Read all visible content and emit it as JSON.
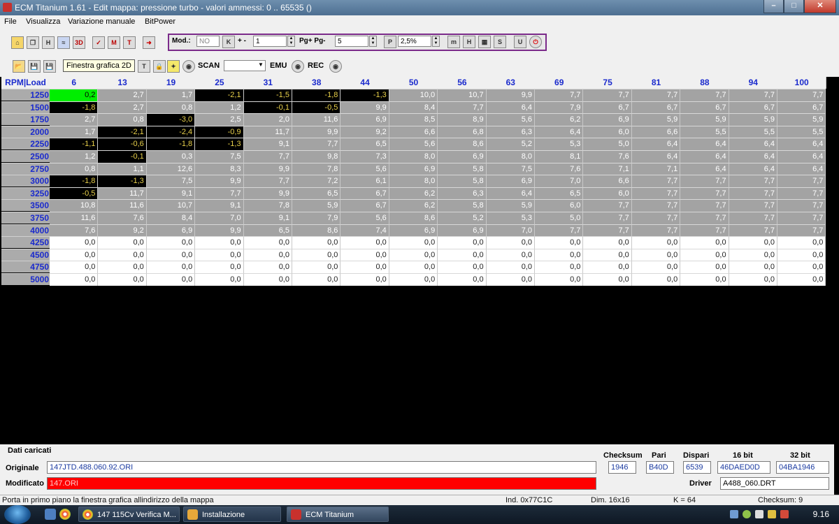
{
  "window": {
    "title": "ECM Titanium 1.61 - Edit mappa: pressione turbo - valori ammessi: 0 .. 65535 ()"
  },
  "menu": [
    "File",
    "Visualizza",
    "Variazione manuale",
    "BitPower"
  ],
  "toolbar": {
    "mod_label": "Mod.:",
    "mod_value": "NO",
    "k_label": "K",
    "plusminus_label": "+ -",
    "step_value": "1",
    "pg_label": "Pg+ Pg-",
    "pg_value": "5",
    "percent_label": "P",
    "percent_value": "2,5%",
    "tooltip": "Finestra grafica 2D",
    "scan_label": "SCAN",
    "scan_value": "",
    "emu_label": "EMU",
    "rec_label": "REC"
  },
  "grid": {
    "corner": "RPM|Load",
    "columns": [
      "6",
      "13",
      "19",
      "25",
      "31",
      "38",
      "44",
      "50",
      "56",
      "63",
      "69",
      "75",
      "81",
      "88",
      "94",
      "100"
    ],
    "rows": [
      {
        "rpm": "1250",
        "values": [
          "0,2",
          "2,7",
          "1,7",
          "-2,1",
          "-1,5",
          "-1,8",
          "-1,3",
          "10,0",
          "10,7",
          "9,9",
          "7,7",
          "7,7",
          "7,7",
          "7,7",
          "7,7",
          "7,7"
        ]
      },
      {
        "rpm": "1500",
        "values": [
          "-1,8",
          "2,7",
          "0,8",
          "1,2",
          "-0,1",
          "-0,5",
          "9,9",
          "8,4",
          "7,7",
          "6,4",
          "7,9",
          "6,7",
          "6,7",
          "6,7",
          "6,7",
          "6,7"
        ]
      },
      {
        "rpm": "1750",
        "values": [
          "2,7",
          "0,8",
          "-3,0",
          "2,5",
          "2,0",
          "11,6",
          "6,9",
          "8,5",
          "8,9",
          "5,6",
          "6,2",
          "6,9",
          "5,9",
          "5,9",
          "5,9",
          "5,9"
        ]
      },
      {
        "rpm": "2000",
        "values": [
          "1,7",
          "-2,1",
          "-2,4",
          "-0,9",
          "11,7",
          "9,9",
          "9,2",
          "6,6",
          "6,8",
          "6,3",
          "6,4",
          "6,0",
          "6,6",
          "5,5",
          "5,5",
          "5,5"
        ]
      },
      {
        "rpm": "2250",
        "values": [
          "-1,1",
          "-0,6",
          "-1,8",
          "-1,3",
          "9,1",
          "7,7",
          "6,5",
          "5,6",
          "8,6",
          "5,2",
          "5,3",
          "5,0",
          "6,4",
          "6,4",
          "6,4",
          "6,4"
        ]
      },
      {
        "rpm": "2500",
        "values": [
          "1,2",
          "-0,1",
          "0,3",
          "7,5",
          "7,7",
          "9,8",
          "7,3",
          "8,0",
          "6,9",
          "8,0",
          "8,1",
          "7,6",
          "6,4",
          "6,4",
          "6,4",
          "6,4"
        ]
      },
      {
        "rpm": "2750",
        "values": [
          "0,8",
          "1,1",
          "12,6",
          "8,3",
          "9,9",
          "7,8",
          "5,6",
          "6,9",
          "5,8",
          "7,5",
          "7,6",
          "7,1",
          "7,1",
          "6,4",
          "6,4",
          "6,4"
        ]
      },
      {
        "rpm": "3000",
        "values": [
          "-1,8",
          "-1,3",
          "7,5",
          "9,9",
          "7,7",
          "7,2",
          "6,1",
          "8,0",
          "5,8",
          "6,9",
          "7,0",
          "6,6",
          "7,7",
          "7,7",
          "7,7",
          "7,7"
        ]
      },
      {
        "rpm": "3250",
        "values": [
          "-0,5",
          "11,7",
          "9,1",
          "7,7",
          "9,9",
          "6,5",
          "6,7",
          "6,2",
          "6,3",
          "6,4",
          "6,5",
          "6,0",
          "7,7",
          "7,7",
          "7,7",
          "7,7"
        ]
      },
      {
        "rpm": "3500",
        "values": [
          "10,8",
          "11,6",
          "10,7",
          "9,1",
          "7,8",
          "5,9",
          "6,7",
          "6,2",
          "5,8",
          "5,9",
          "6,0",
          "7,7",
          "7,7",
          "7,7",
          "7,7",
          "7,7"
        ]
      },
      {
        "rpm": "3750",
        "values": [
          "11,6",
          "7,6",
          "8,4",
          "7,0",
          "9,1",
          "7,9",
          "5,6",
          "8,6",
          "5,2",
          "5,3",
          "5,0",
          "7,7",
          "7,7",
          "7,7",
          "7,7",
          "7,7"
        ]
      },
      {
        "rpm": "4000",
        "values": [
          "7,6",
          "9,2",
          "6,9",
          "9,9",
          "6,5",
          "8,6",
          "7,4",
          "6,9",
          "6,9",
          "7,0",
          "7,7",
          "7,7",
          "7,7",
          "7,7",
          "7,7",
          "7,7"
        ]
      },
      {
        "rpm": "4250",
        "values": [
          "0,0",
          "0,0",
          "0,0",
          "0,0",
          "0,0",
          "0,0",
          "0,0",
          "0,0",
          "0,0",
          "0,0",
          "0,0",
          "0,0",
          "0,0",
          "0,0",
          "0,0",
          "0,0"
        ]
      },
      {
        "rpm": "4500",
        "values": [
          "0,0",
          "0,0",
          "0,0",
          "0,0",
          "0,0",
          "0,0",
          "0,0",
          "0,0",
          "0,0",
          "0,0",
          "0,0",
          "0,0",
          "0,0",
          "0,0",
          "0,0",
          "0,0"
        ]
      },
      {
        "rpm": "4750",
        "values": [
          "0,0",
          "0,0",
          "0,0",
          "0,0",
          "0,0",
          "0,0",
          "0,0",
          "0,0",
          "0,0",
          "0,0",
          "0,0",
          "0,0",
          "0,0",
          "0,0",
          "0,0",
          "0,0"
        ]
      },
      {
        "rpm": "5000",
        "values": [
          "0,0",
          "0,0",
          "0,0",
          "0,0",
          "0,0",
          "0,0",
          "0,0",
          "0,0",
          "0,0",
          "0,0",
          "0,0",
          "0,0",
          "0,0",
          "0,0",
          "0,0",
          "0,0"
        ]
      }
    ],
    "colors": {
      "grey": "#a3a3a3",
      "white": "#ffffff",
      "black": "#000000",
      "highlight": "#00ee00",
      "negative_text": "#e8d04a",
      "header_text": "#1a2acd"
    }
  },
  "bottom": {
    "section_label": "Dati caricati",
    "originale_label": "Originale",
    "originale_value": "147JTD.488.060.92.ORI",
    "modificato_label": "Modificato",
    "modificato_value": "147.ORI",
    "checksum_label": "Checksum",
    "checksum_value": "1946",
    "pari_label": "Pari",
    "pari_value": "B40D",
    "dispari_label": "Dispari",
    "dispari_value": "6539",
    "bit16_label": "16 bit",
    "bit16_value": "46DAED0D",
    "bit32_label": "32 bit",
    "bit32_value": "04BA1946",
    "driver_label": "Driver",
    "driver_value": "A488_060.DRT"
  },
  "status": {
    "message": "Porta in primo piano la finestra grafica allindirizzo della mappa",
    "ind": "Ind. 0x77C1C",
    "dim": "Dim. 16x16",
    "k": "K = 64",
    "checksum": "Checksum: 9"
  },
  "taskbar": {
    "items": [
      "147 115Cv Verifica M...",
      "Installazione",
      "ECM Titanium"
    ],
    "clock": "9.16"
  }
}
